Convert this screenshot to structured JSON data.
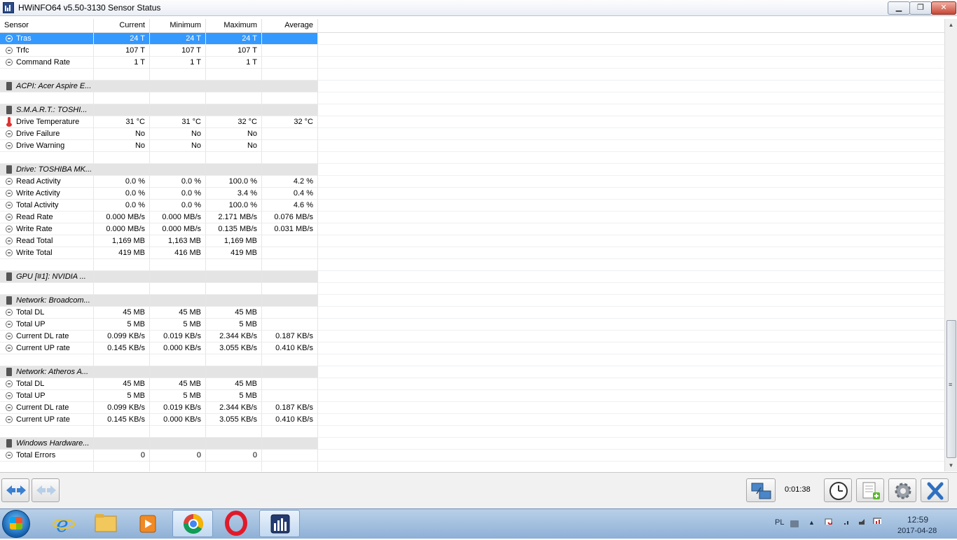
{
  "window": {
    "title": "HWiNFO64 v5.50-3130 Sensor Status"
  },
  "columns": [
    "Sensor",
    "Current",
    "Minimum",
    "Maximum",
    "Average"
  ],
  "rows": [
    {
      "type": "item",
      "icon": "gauge-icon",
      "sel": true,
      "cells": [
        "Tras",
        "24 T",
        "24 T",
        "24 T",
        ""
      ]
    },
    {
      "type": "item",
      "icon": "gauge-icon",
      "cells": [
        "Trfc",
        "107 T",
        "107 T",
        "107 T",
        ""
      ]
    },
    {
      "type": "item",
      "icon": "gauge-icon",
      "cells": [
        "Command Rate",
        "1 T",
        "1 T",
        "1 T",
        ""
      ]
    },
    {
      "type": "blank"
    },
    {
      "type": "group",
      "cells": [
        "ACPI: Acer Aspire E...",
        "",
        "",
        "",
        ""
      ]
    },
    {
      "type": "blank"
    },
    {
      "type": "group",
      "cells": [
        "S.M.A.R.T.: TOSHI...",
        "",
        "",
        "",
        ""
      ]
    },
    {
      "type": "item",
      "icon": "thermometer-icon",
      "cells": [
        "Drive Temperature",
        "31 °C",
        "31 °C",
        "32 °C",
        "32 °C"
      ]
    },
    {
      "type": "item",
      "icon": "gauge-icon",
      "cells": [
        "Drive Failure",
        "No",
        "No",
        "No",
        ""
      ]
    },
    {
      "type": "item",
      "icon": "gauge-icon",
      "cells": [
        "Drive Warning",
        "No",
        "No",
        "No",
        ""
      ]
    },
    {
      "type": "blank"
    },
    {
      "type": "group",
      "cells": [
        "Drive: TOSHIBA MK...",
        "",
        "",
        "",
        ""
      ]
    },
    {
      "type": "item",
      "icon": "gauge-icon",
      "cells": [
        "Read Activity",
        "0.0 %",
        "0.0 %",
        "100.0 %",
        "4.2 %"
      ]
    },
    {
      "type": "item",
      "icon": "gauge-icon",
      "cells": [
        "Write Activity",
        "0.0 %",
        "0.0 %",
        "3.4 %",
        "0.4 %"
      ]
    },
    {
      "type": "item",
      "icon": "gauge-icon",
      "cells": [
        "Total Activity",
        "0.0 %",
        "0.0 %",
        "100.0 %",
        "4.6 %"
      ]
    },
    {
      "type": "item",
      "icon": "gauge-icon",
      "cells": [
        "Read Rate",
        "0.000 MB/s",
        "0.000 MB/s",
        "2.171 MB/s",
        "0.076 MB/s"
      ]
    },
    {
      "type": "item",
      "icon": "gauge-icon",
      "cells": [
        "Write Rate",
        "0.000 MB/s",
        "0.000 MB/s",
        "0.135 MB/s",
        "0.031 MB/s"
      ]
    },
    {
      "type": "item",
      "icon": "gauge-icon",
      "cells": [
        "Read Total",
        "1,169 MB",
        "1,163 MB",
        "1,169 MB",
        ""
      ]
    },
    {
      "type": "item",
      "icon": "gauge-icon",
      "cells": [
        "Write Total",
        "419 MB",
        "416 MB",
        "419 MB",
        ""
      ]
    },
    {
      "type": "blank"
    },
    {
      "type": "group",
      "cells": [
        "GPU [#1]: NVIDIA ...",
        "",
        "",
        "",
        ""
      ]
    },
    {
      "type": "blank"
    },
    {
      "type": "group",
      "cells": [
        "Network: Broadcom...",
        "",
        "",
        "",
        ""
      ]
    },
    {
      "type": "item",
      "icon": "gauge-icon",
      "cells": [
        "Total DL",
        "45 MB",
        "45 MB",
        "45 MB",
        ""
      ]
    },
    {
      "type": "item",
      "icon": "gauge-icon",
      "cells": [
        "Total UP",
        "5 MB",
        "5 MB",
        "5 MB",
        ""
      ]
    },
    {
      "type": "item",
      "icon": "gauge-icon",
      "cells": [
        "Current DL rate",
        "0.099 KB/s",
        "0.019 KB/s",
        "2.344 KB/s",
        "0.187 KB/s"
      ]
    },
    {
      "type": "item",
      "icon": "gauge-icon",
      "cells": [
        "Current UP rate",
        "0.145 KB/s",
        "0.000 KB/s",
        "3.055 KB/s",
        "0.410 KB/s"
      ]
    },
    {
      "type": "blank"
    },
    {
      "type": "group",
      "cells": [
        "Network: Atheros A...",
        "",
        "",
        "",
        ""
      ]
    },
    {
      "type": "item",
      "icon": "gauge-icon",
      "cells": [
        "Total DL",
        "45 MB",
        "45 MB",
        "45 MB",
        ""
      ]
    },
    {
      "type": "item",
      "icon": "gauge-icon",
      "cells": [
        "Total UP",
        "5 MB",
        "5 MB",
        "5 MB",
        ""
      ]
    },
    {
      "type": "item",
      "icon": "gauge-icon",
      "cells": [
        "Current DL rate",
        "0.099 KB/s",
        "0.019 KB/s",
        "2.344 KB/s",
        "0.187 KB/s"
      ]
    },
    {
      "type": "item",
      "icon": "gauge-icon",
      "cells": [
        "Current UP rate",
        "0.145 KB/s",
        "0.000 KB/s",
        "3.055 KB/s",
        "0.410 KB/s"
      ]
    },
    {
      "type": "blank"
    },
    {
      "type": "group",
      "cells": [
        "Windows Hardware...",
        "",
        "",
        "",
        ""
      ]
    },
    {
      "type": "item",
      "icon": "gauge-icon",
      "cells": [
        "Total Errors",
        "0",
        "0",
        "0",
        ""
      ]
    },
    {
      "type": "blank"
    }
  ],
  "toolbar": {
    "elapsed": "0:01:38"
  },
  "taskbar": {
    "language": "PL",
    "time": "12:59",
    "date": "2017-04-28"
  },
  "colors": {
    "selection": "#3399ff",
    "group_row": "#e4e4e4",
    "close_button": "#c74634"
  }
}
